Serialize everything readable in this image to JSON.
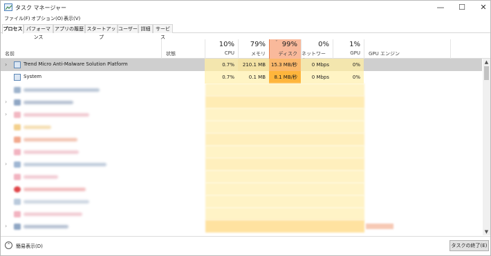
{
  "window": {
    "title": "タスク マネージャー",
    "min_glyph": "—",
    "max_glyph": "☐",
    "close_glyph": "✕"
  },
  "menu": [
    "ファイル(F)",
    "オプション(O)",
    "表示(V)"
  ],
  "tabs": [
    {
      "label": "プロセス",
      "active": true
    },
    {
      "label": "パフォーマンス",
      "active": false
    },
    {
      "label": "アプリの履歴",
      "active": false
    },
    {
      "label": "スタートアップ",
      "active": false
    },
    {
      "label": "ユーザー",
      "active": false
    },
    {
      "label": "詳細",
      "active": false
    },
    {
      "label": "サービス",
      "active": false
    }
  ],
  "columns": {
    "name": "名前",
    "status": "状態",
    "cpu": {
      "pct": "10%",
      "label": "CPU"
    },
    "memory": {
      "pct": "79%",
      "label": "メモリ"
    },
    "disk": {
      "pct": "99%",
      "label": "ディスク",
      "sort_glyph": "ˇ"
    },
    "network": {
      "pct": "0%",
      "label": "ネットワーク"
    },
    "gpu": {
      "pct": "1%",
      "label": "GPU"
    },
    "gpu_engine": "GPU エンジン"
  },
  "processes": [
    {
      "name": "Trend Micro Anti-Malware Solution Platform",
      "expander": "›",
      "selected": true,
      "cpu": "0.7%",
      "memory": "210.1 MB",
      "disk": "15.3 MB/秒",
      "network": "0 Mbps",
      "gpu": "0%"
    },
    {
      "name": "System",
      "expander": "",
      "selected": false,
      "cpu": "0.7%",
      "memory": "0.1 MB",
      "disk": "8.1 MB/秒",
      "network": "0 Mbps",
      "gpu": "0%"
    }
  ],
  "scrollbar": {
    "up": "▲",
    "down": "▼"
  },
  "footer": {
    "fewer_details_glyph": "⌃",
    "fewer_details": "簡易表示(D)",
    "end_task": "タスクの終了(E)"
  },
  "colors": {
    "cpu_bg": "#fff4c4",
    "disk_selected_bg": "#f9b99b",
    "disk_bg": "#ffd27a",
    "mem_bg": "#fff0bf",
    "disk_heat_bg": "#ffb94a",
    "selected_row": "#cfcfcf"
  }
}
